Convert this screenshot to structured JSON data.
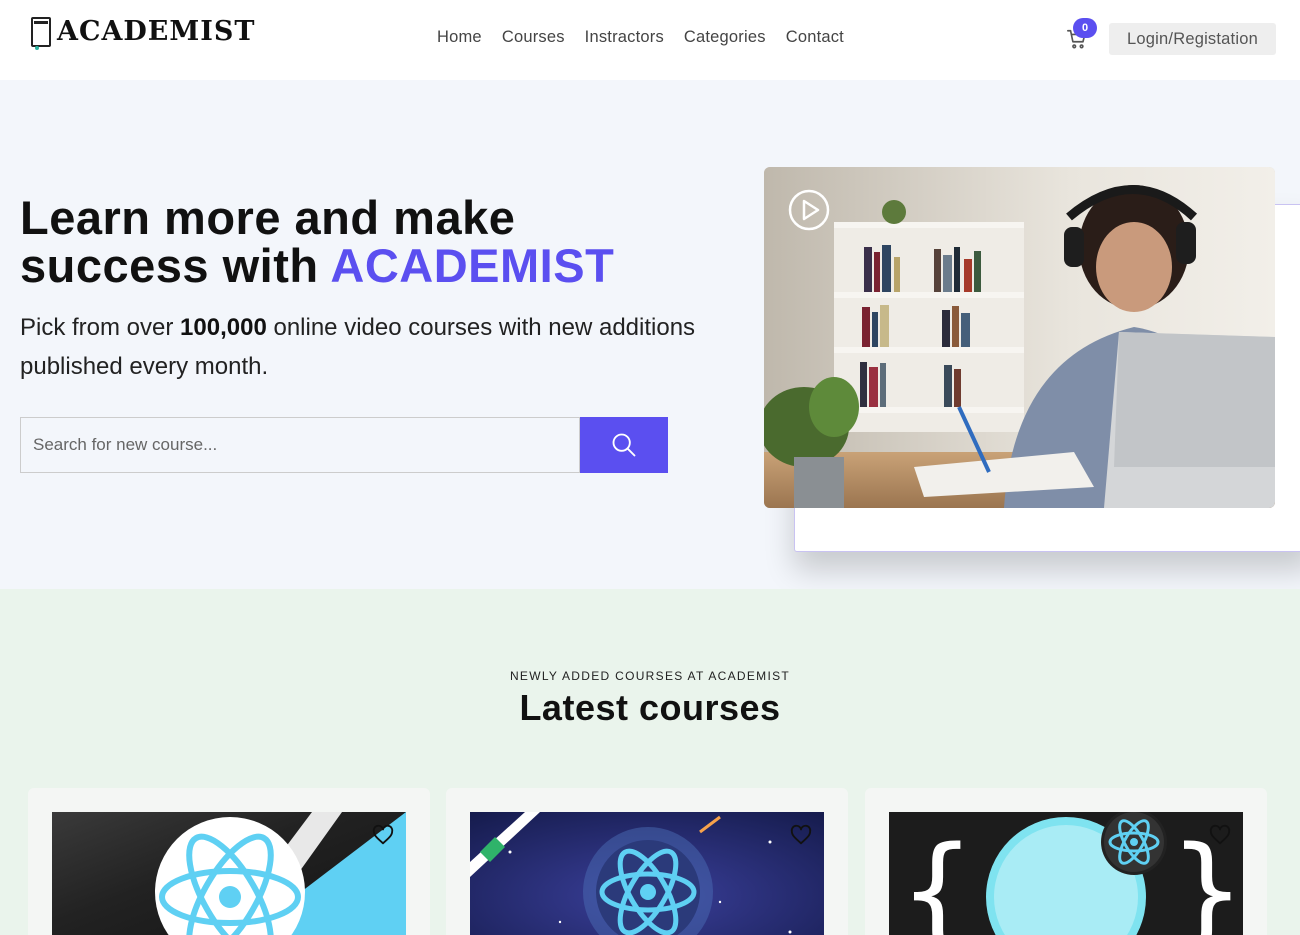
{
  "header": {
    "logo_text": "ACADEMIST",
    "nav": [
      "Home",
      "Courses",
      "Instractors",
      "Categories",
      "Contact"
    ],
    "cart_count": "0",
    "login_label": "Login/Registation"
  },
  "hero": {
    "title_line1": "Learn more and make",
    "title_line2_prefix": "success with ",
    "title_accent": "ACADEMIST",
    "sub_prefix": "Pick from over ",
    "sub_bold": "100,000",
    "sub_suffix": " online video courses with new additions published every month.",
    "search_placeholder": "Search for new course..."
  },
  "latest": {
    "kicker": "NEWLY ADDED COURSES AT ACADEMIST",
    "title": "Latest courses"
  },
  "colors": {
    "accent": "#5b4ff0",
    "hero_bg": "#f3f6fb",
    "latest_bg": "#eaf4ec"
  },
  "icons": [
    "cart-icon",
    "search-icon",
    "play-icon",
    "heart-icon",
    "react-logo-icon"
  ]
}
